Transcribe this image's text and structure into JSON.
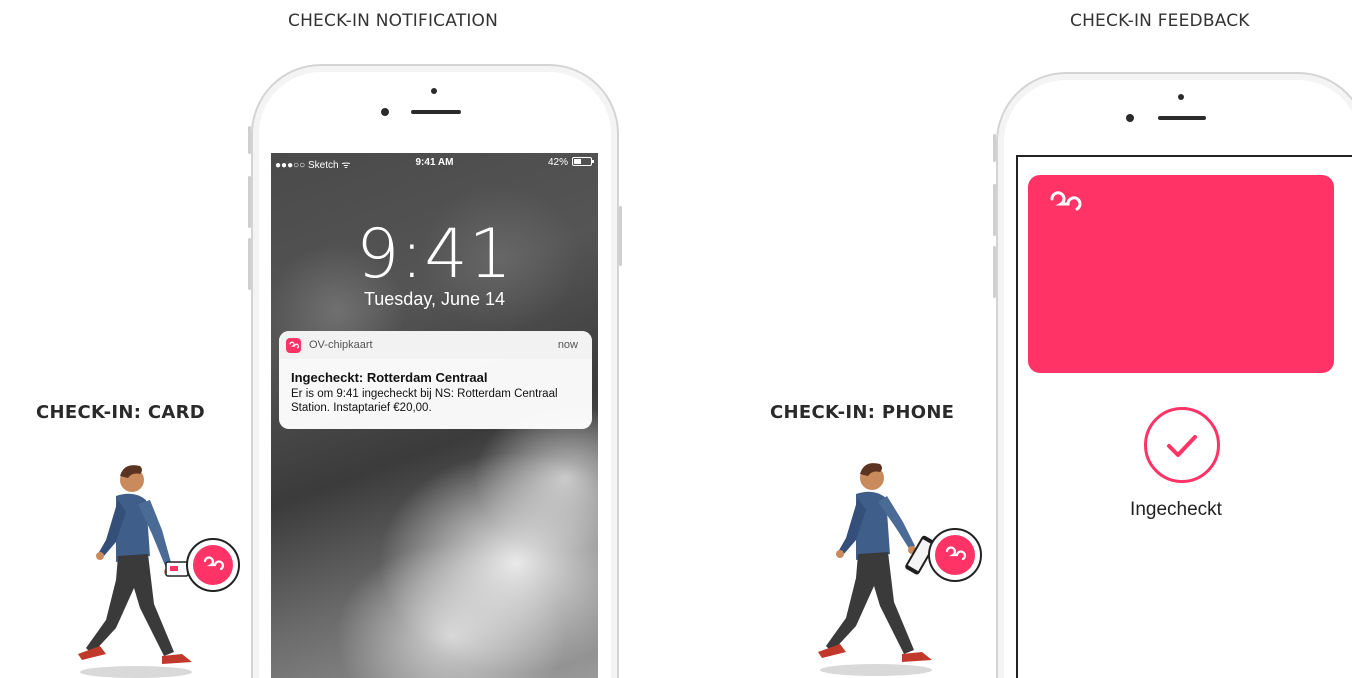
{
  "sections": {
    "notification_title": "CHECK-IN NOTIFICATION",
    "feedback_title": "CHECK-IN FEEDBACK"
  },
  "labels": {
    "card": "CHECK-IN: CARD",
    "phone": "CHECK-IN: PHONE"
  },
  "lockscreen": {
    "carrier": "●●●○○ Sketch ᯤ",
    "status_time": "9:41 AM",
    "battery": "42%",
    "battery_level": 0.42,
    "clock": "9:41",
    "date": "Tuesday, June 14"
  },
  "notification": {
    "app_name": "OV-chipkaart",
    "when": "now",
    "title": "Ingecheckt: Rotterdam Centraal",
    "body": "Er is om 9:41 ingecheckt bij NS: Rotterdam Centraal Station. Instaptarief €20,00."
  },
  "feedback": {
    "status": "Ingecheckt"
  },
  "colors": {
    "brand": "#ff3366",
    "text": "#222222"
  },
  "icons": {
    "brand_logo": "ov-logo-icon",
    "check": "checkmark-icon"
  }
}
